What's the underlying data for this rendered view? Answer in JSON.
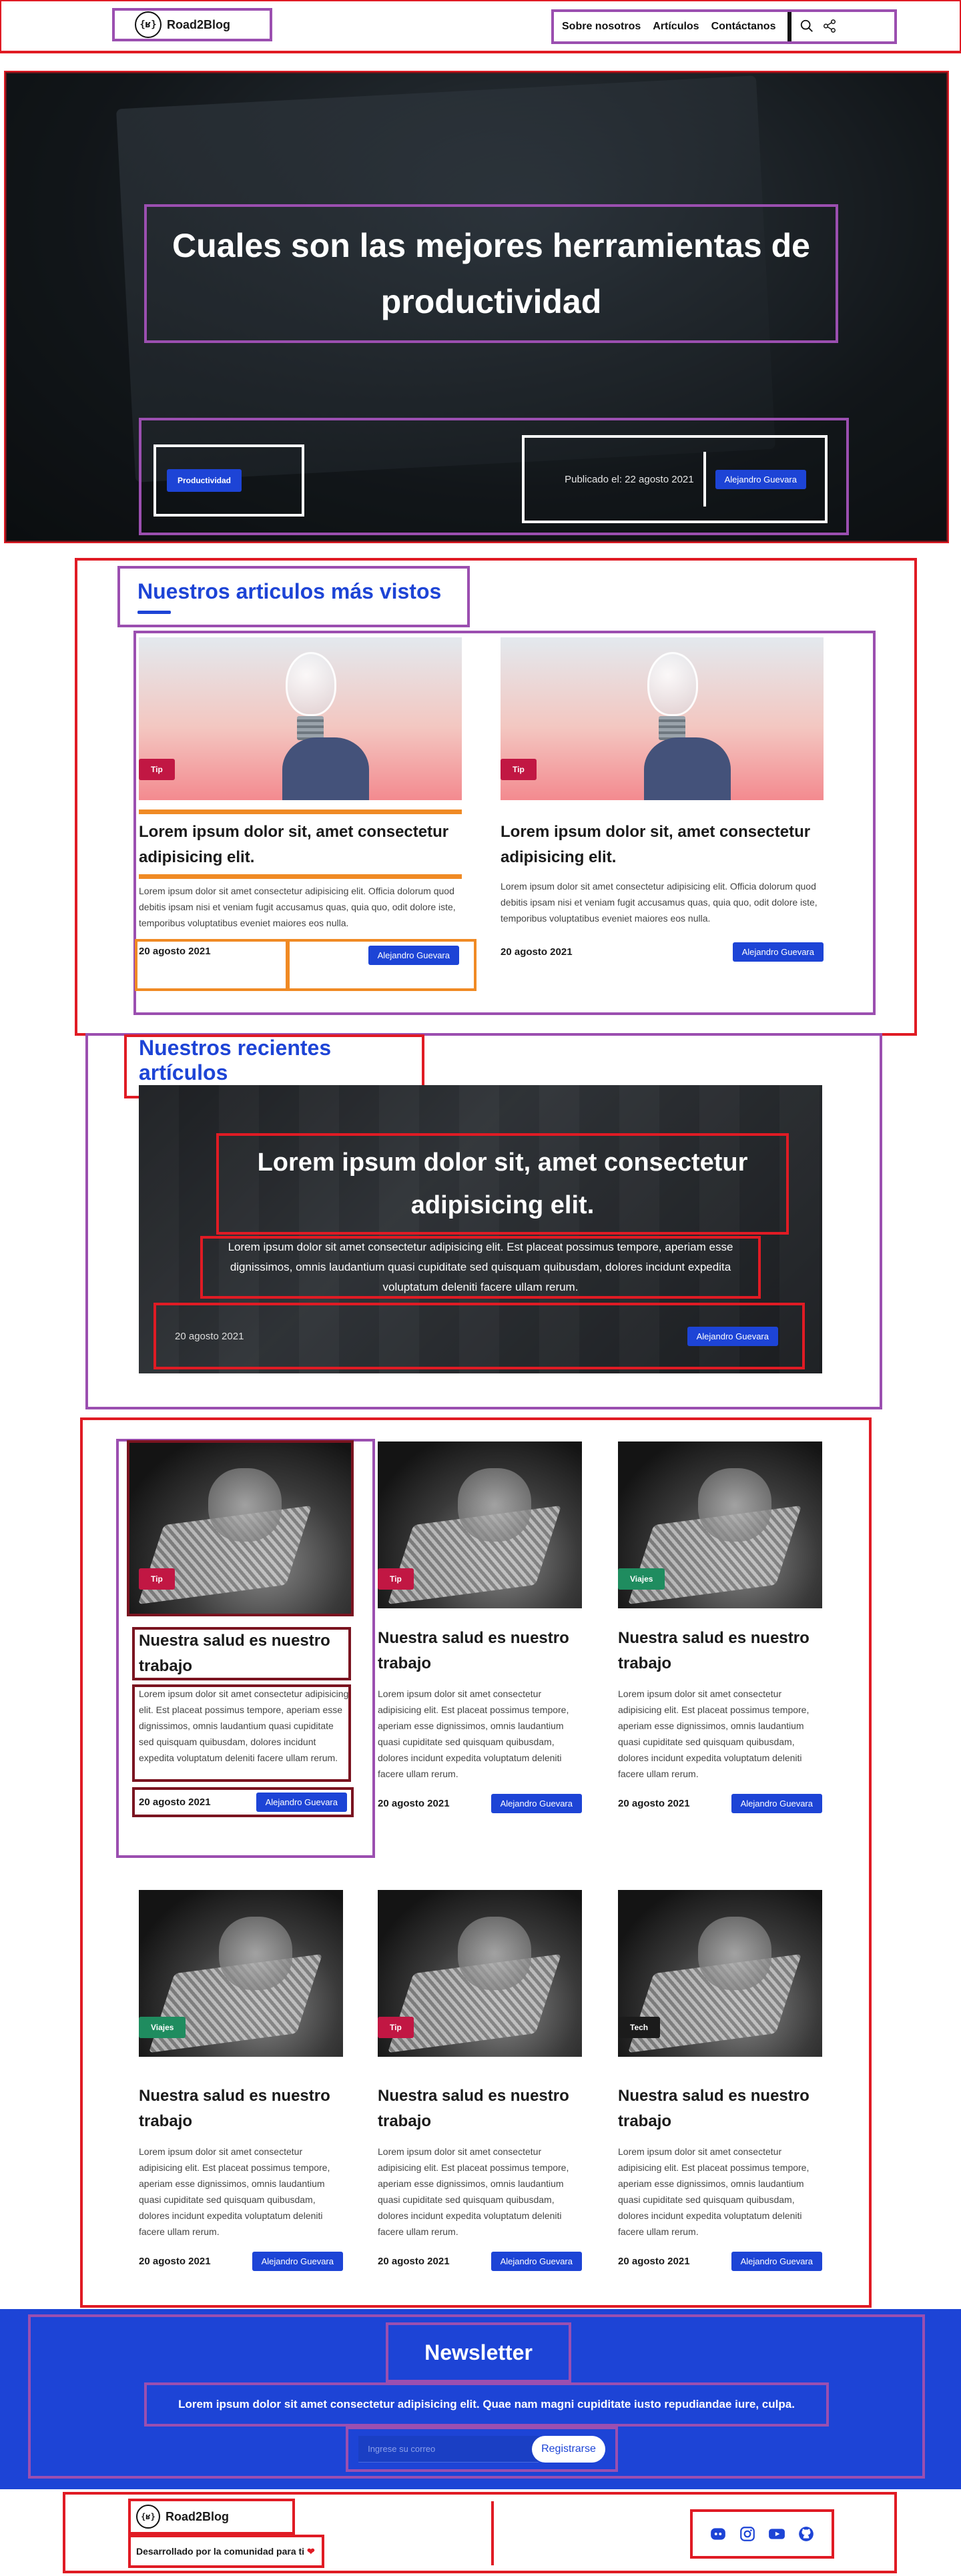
{
  "header": {
    "brand": "Road2Blog",
    "logo_glyph": "{ʁ}",
    "nav": [
      "Sobre nosotros",
      "Artículos",
      "Contáctanos"
    ],
    "icons": [
      "search-icon",
      "share-icon"
    ]
  },
  "hero": {
    "title": "Cuales son las mejores herramientas de productividad",
    "tag": "Productividad",
    "date": "Publicado el: 22 agosto 2021",
    "author": "Alejandro Guevara"
  },
  "most_viewed": {
    "heading": "Nuestros articulos más vistos",
    "cards": [
      {
        "tag": "Tip",
        "title": "Lorem ipsum dolor sit, amet consectetur adipisicing elit.",
        "desc": "Lorem ipsum dolor sit amet consectetur adipisicing elit. Officia dolorum quod debitis ipsam nisi et veniam fugit accusamus quas, quia quo, odit dolore iste, temporibus voluptatibus eveniet maiores eos nulla.",
        "date": "20 agosto 2021",
        "author": "Alejandro Guevara"
      },
      {
        "tag": "Tip",
        "title": "Lorem ipsum dolor sit, amet consectetur adipisicing elit.",
        "desc": "Lorem ipsum dolor sit amet consectetur adipisicing elit. Officia dolorum quod debitis ipsam nisi et veniam fugit accusamus quas, quia quo, odit dolore iste, temporibus voluptatibus eveniet maiores eos nulla.",
        "date": "20 agosto 2021",
        "author": "Alejandro Guevara"
      }
    ]
  },
  "recent": {
    "heading": "Nuestros recientes artículos",
    "feature": {
      "title": "Lorem ipsum dolor sit, amet consectetur adipisicing elit.",
      "desc": "Lorem ipsum dolor sit amet consectetur adipisicing elit. Est placeat possimus tempore, aperiam esse dignissimos, omnis laudantium quasi cupiditate sed quisquam quibusdam, dolores incidunt expedita voluptatum deleniti facere ullam rerum.",
      "date": "20 agosto 2021",
      "author": "Alejandro Guevara"
    }
  },
  "grid": {
    "cards": [
      {
        "tag": "Tip",
        "tag_color": "#c11743",
        "title": "Nuestra salud es nuestro trabajo",
        "desc": "Lorem ipsum dolor sit amet consectetur adipisicing elit. Est placeat possimus tempore, aperiam esse dignissimos, omnis laudantium quasi cupiditate sed quisquam quibusdam, dolores incidunt expedita voluptatum deleniti facere ullam rerum.",
        "date": "20 agosto 2021",
        "author": "Alejandro Guevara"
      },
      {
        "tag": "Tip",
        "tag_color": "#c11743",
        "title": "Nuestra salud es nuestro trabajo",
        "desc": "Lorem ipsum dolor sit amet consectetur adipisicing elit. Est placeat possimus tempore, aperiam esse dignissimos, omnis laudantium quasi cupiditate sed quisquam quibusdam, dolores incidunt expedita voluptatum deleniti facere ullam rerum.",
        "date": "20 agosto 2021",
        "author": "Alejandro Guevara"
      },
      {
        "tag": "Viajes",
        "tag_color": "#1f8c5f",
        "title": "Nuestra salud es nuestro trabajo",
        "desc": "Lorem ipsum dolor sit amet consectetur adipisicing elit. Est placeat possimus tempore, aperiam esse dignissimos, omnis laudantium quasi cupiditate sed quisquam quibusdam, dolores incidunt expedita voluptatum deleniti facere ullam rerum.",
        "date": "20 agosto 2021",
        "author": "Alejandro Guevara"
      },
      {
        "tag": "Viajes",
        "tag_color": "#1f8c5f",
        "title": "Nuestra salud es nuestro trabajo",
        "desc": "Lorem ipsum dolor sit amet consectetur adipisicing elit. Est placeat possimus tempore, aperiam esse dignissimos, omnis laudantium quasi cupiditate sed quisquam quibusdam, dolores incidunt expedita voluptatum deleniti facere ullam rerum.",
        "date": "20 agosto 2021",
        "author": "Alejandro Guevara"
      },
      {
        "tag": "Tip",
        "tag_color": "#c11743",
        "title": "Nuestra salud es nuestro trabajo",
        "desc": "Lorem ipsum dolor sit amet consectetur adipisicing elit. Est placeat possimus tempore, aperiam esse dignissimos, omnis laudantium quasi cupiditate sed quisquam quibusdam, dolores incidunt expedita voluptatum deleniti facere ullam rerum.",
        "date": "20 agosto 2021",
        "author": "Alejandro Guevara"
      },
      {
        "tag": "Tech",
        "tag_color": "#1b1b1b",
        "title": "Nuestra salud es nuestro trabajo",
        "desc": "Lorem ipsum dolor sit amet consectetur adipisicing elit. Est placeat possimus tempore, aperiam esse dignissimos, omnis laudantium quasi cupiditate sed quisquam quibusdam, dolores incidunt expedita voluptatum deleniti facere ullam rerum.",
        "date": "20 agosto 2021",
        "author": "Alejandro Guevara"
      }
    ]
  },
  "newsletter": {
    "title": "Newsletter",
    "text": "Lorem ipsum dolor sit amet consectetur adipisicing elit. Quae nam magni cupiditate iusto repudiandae iure, culpa.",
    "placeholder": "Ingrese su correo",
    "button": "Registrarse"
  },
  "footer": {
    "brand": "Road2Blog",
    "tagline": "Desarrollado por la comunidad para ti",
    "heart": "❤",
    "social": [
      "discord-icon",
      "instagram-icon",
      "youtube-icon",
      "github-icon"
    ]
  },
  "colors": {
    "accent": "#1d44d6",
    "tip": "#c11743",
    "viajes": "#1f8c5f",
    "tech": "#1b1b1b"
  }
}
